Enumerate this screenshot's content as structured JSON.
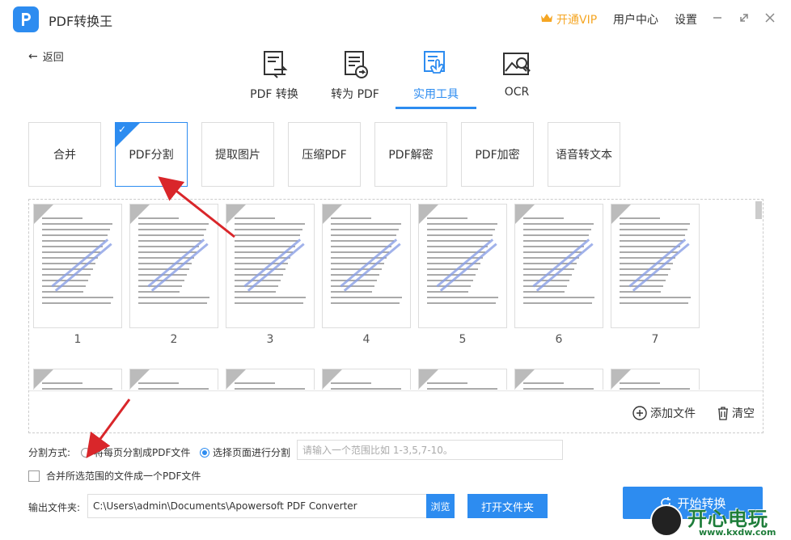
{
  "app": {
    "title": "PDF转换王",
    "vip_label": "开通VIP",
    "user_center": "用户中心",
    "settings": "设置"
  },
  "back_label": "返回",
  "nav": [
    {
      "label": "PDF 转换",
      "icon": "pdf-convert-icon"
    },
    {
      "label": "转为 PDF",
      "icon": "to-pdf-icon"
    },
    {
      "label": "实用工具",
      "icon": "tools-icon",
      "active": true
    },
    {
      "label": "OCR",
      "icon": "ocr-icon"
    }
  ],
  "tools": [
    "合并",
    "PDF分割",
    "提取图片",
    "压缩PDF",
    "PDF解密",
    "PDF加密",
    "语音转文本"
  ],
  "active_tool": "PDF分割",
  "pages": [
    "1",
    "2",
    "3",
    "4",
    "5",
    "6",
    "7"
  ],
  "file_actions": {
    "add": "添加文件",
    "clear": "清空"
  },
  "split": {
    "label": "分割方式:",
    "option_each": "将每页分割成PDF文件",
    "option_select": "选择页面进行分割",
    "selected": "option_select",
    "range_placeholder": "请输入一个范围比如 1-3,5,7-10。"
  },
  "merge_label": "合并所选范围的文件成一个PDF文件",
  "output": {
    "label": "输出文件夹:",
    "path": "C:\\Users\\admin\\Documents\\Apowersoft PDF Converter",
    "browse": "浏览",
    "open_folder": "打开文件夹"
  },
  "start_label": "开始转换",
  "watermark": {
    "brand": "开心电玩",
    "site": "www.kxdw.com"
  },
  "colors": {
    "accent": "#2d8cf0",
    "vip": "#f5a623",
    "annotation_arrow": "#d9262a"
  }
}
